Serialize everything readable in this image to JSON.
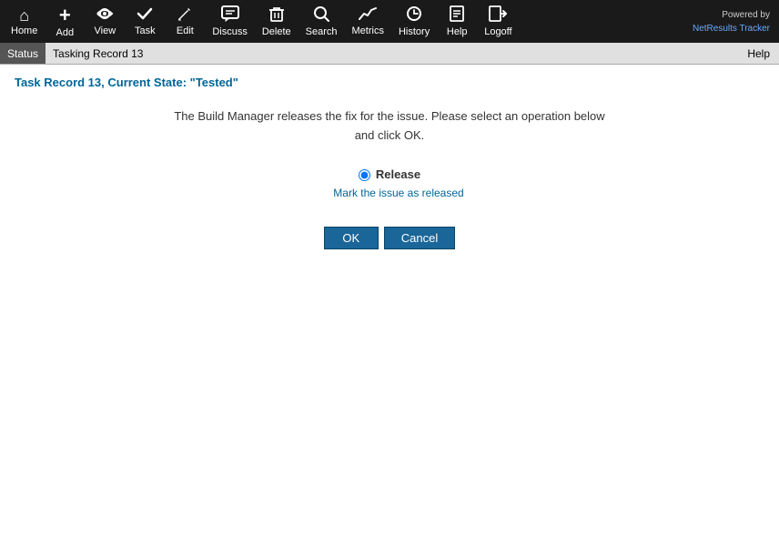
{
  "navbar": {
    "brand": "Powered by",
    "brand_link": "NetResults Tracker",
    "items": [
      {
        "id": "home",
        "label": "Home",
        "icon": "⌂"
      },
      {
        "id": "add",
        "label": "Add",
        "icon": "+"
      },
      {
        "id": "view",
        "label": "View",
        "icon": "👁"
      },
      {
        "id": "task",
        "label": "Task",
        "icon": "✓"
      },
      {
        "id": "edit",
        "label": "Edit",
        "icon": "✎"
      },
      {
        "id": "discuss",
        "label": "Discuss",
        "icon": "💬"
      },
      {
        "id": "delete",
        "label": "Delete",
        "icon": "🗑"
      },
      {
        "id": "search",
        "label": "Search",
        "icon": "🔍"
      },
      {
        "id": "metrics",
        "label": "Metrics",
        "icon": "📈"
      },
      {
        "id": "history",
        "label": "History",
        "icon": "🕐"
      },
      {
        "id": "help",
        "label": "Help",
        "icon": "📋"
      },
      {
        "id": "logoff",
        "label": "Logoff",
        "icon": "↪"
      }
    ]
  },
  "statusbar": {
    "status_label": "Status",
    "record_label": "Tasking Record 13",
    "help_label": "Help"
  },
  "main": {
    "page_title": "Task Record 13, Current State: \"Tested\"",
    "instruction_line1": "The Build Manager releases the fix for the issue. Please select an operation below",
    "instruction_line2": "and click OK.",
    "operation": {
      "label": "Release",
      "description": "Mark the issue as released"
    },
    "ok_button": "OK",
    "cancel_button": "Cancel"
  }
}
